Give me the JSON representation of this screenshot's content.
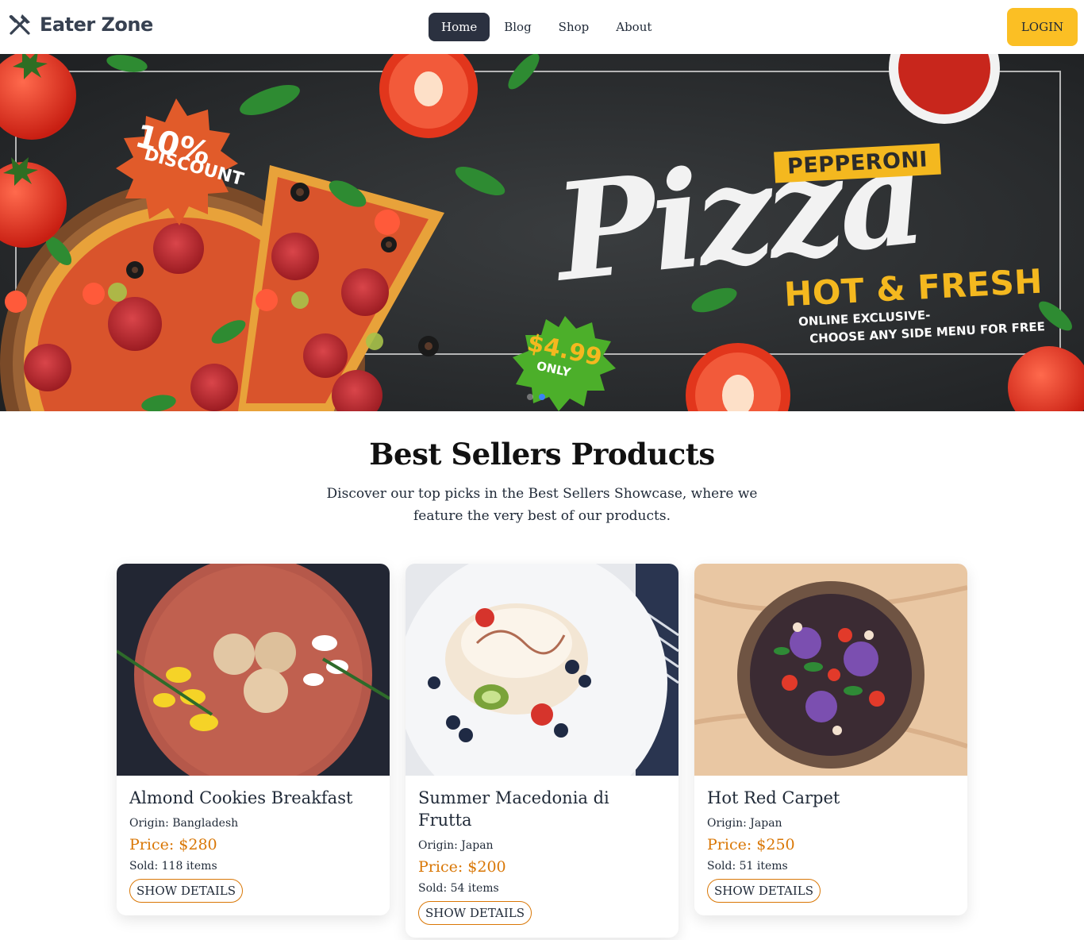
{
  "header": {
    "brand": "Eater Zone",
    "brand_icon": "fork-knife-icon",
    "nav": [
      {
        "label": "Home",
        "active": true
      },
      {
        "label": "Blog",
        "active": false
      },
      {
        "label": "Shop",
        "active": false
      },
      {
        "label": "About",
        "active": false
      }
    ],
    "login_label": "LOGIN",
    "accent_color": "#fbbf24"
  },
  "hero": {
    "discount_top": "10%",
    "discount_bottom": "DISCOUNT",
    "pepperoni": "PEPPERONI",
    "pizza": "Pizza",
    "hot_fresh": "HOT & FRESH",
    "online_line1": "ONLINE EXCLUSIVE-",
    "online_line2": "CHOOSE ANY SIDE MENU FOR FREE",
    "price": "$4.99",
    "price_only": "ONLY"
  },
  "best_sellers": {
    "title": "Best Sellers Products",
    "subtitle": "Discover our top picks in the Best Sellers Showcase, where we feature the very best of our products.",
    "products": [
      {
        "title": "Almond Cookies Breakfast",
        "origin": "Origin: Bangladesh",
        "price": "Price: $280",
        "sold": "Sold: 118 items",
        "button": "SHOW DETAILS"
      },
      {
        "title": "Summer Macedonia di Frutta",
        "origin": "Origin: Japan",
        "price": "Price: $200",
        "sold": "Sold: 54 items",
        "button": "SHOW DETAILS"
      },
      {
        "title": "Hot Red Carpet",
        "origin": "Origin: Japan",
        "price": "Price: $250",
        "sold": "Sold: 51 items",
        "button": "SHOW DETAILS"
      }
    ],
    "price_color": "#d97706"
  }
}
